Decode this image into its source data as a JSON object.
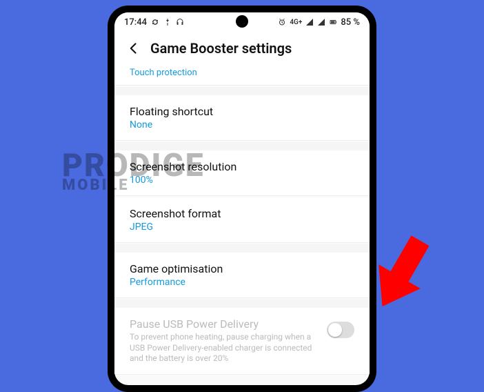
{
  "status": {
    "time": "17:44",
    "net": "4G+",
    "battery": "85 %"
  },
  "header": {
    "title": "Game Booster settings"
  },
  "items": {
    "touch": {
      "sub": "Touch protection"
    },
    "shortcut": {
      "title": "Floating shortcut",
      "sub": "None"
    },
    "resolution": {
      "title": "Screenshot resolution",
      "sub": "100%"
    },
    "format": {
      "title": "Screenshot format",
      "sub": "JPEG"
    },
    "optimisation": {
      "title": "Game optimisation",
      "sub": "Performance"
    },
    "pause": {
      "title": "Pause USB Power Delivery",
      "desc": "To prevent phone heating, pause charging when a USB Power Delivery-enabled charger is connected and the battery is over 20%"
    }
  },
  "watermark": {
    "line1": "PRODIGE",
    "line2": "MOBILE"
  }
}
